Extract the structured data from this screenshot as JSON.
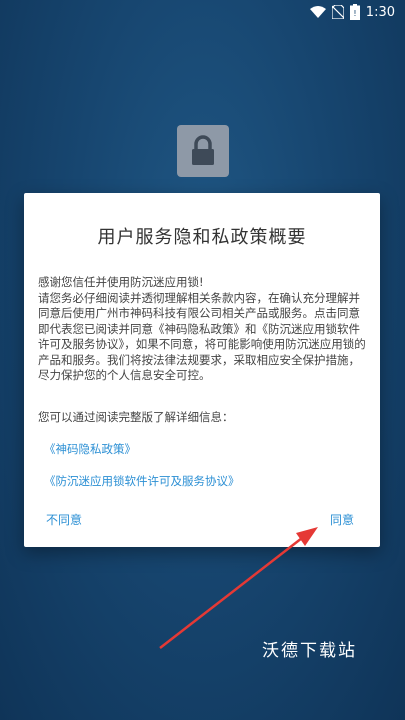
{
  "status_bar": {
    "time": "1:30",
    "icons": [
      "wifi-icon",
      "no-sim-icon",
      "battery-icon"
    ]
  },
  "app": {
    "icon": "padlock-icon"
  },
  "dialog": {
    "title": "用户服务隐和私政策概要",
    "paragraphs": [
      "感谢您信任并使用防沉迷应用锁!",
      "请您务必仔细阅读并透彻理解相关条款内容，在确认充分理解并同意后使用广州市神码科技有限公司相关产品或服务。点击同意即代表您已阅读并同意《神码隐私政策》和《防沉迷应用锁软件许可及服务协议》，如果不同意，将可能影响使用防沉迷应用锁的产品和服务。我们将按法律法规要求，采取相应安全保护措施，尽力保护您的个人信息安全可控。"
    ],
    "hint": "您可以通过阅读完整版了解详细信息：",
    "links": [
      "《神码隐私政策》",
      "《防沉迷应用锁软件许可及服务协议》"
    ],
    "buttons": {
      "disagree": "不同意",
      "agree": "同意"
    }
  },
  "watermark": "沃德下载站",
  "colors": {
    "background": "#174670",
    "link": "#2b8fd4",
    "arrow": "#e53935"
  }
}
